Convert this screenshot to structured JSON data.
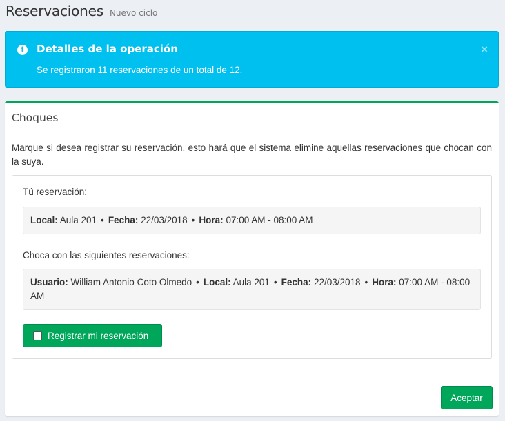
{
  "header": {
    "title": "Reservaciones",
    "subtitle": "Nuevo ciclo"
  },
  "alert": {
    "icon": "info-icon",
    "title": "Detalles de la operación",
    "message": "Se registraron 11 reservaciones de un total de 12.",
    "close_label": "×",
    "color": "#00c0ef"
  },
  "box": {
    "title": "Choques",
    "accent_color": "#00a65a",
    "description": "Marque si desea registrar su reservación, esto hará que el sistema elimine aquellas reservaciones que chocan con la suya.",
    "your_reservation_label": "Tú reservación:",
    "your_reservation": {
      "local_label": "Local:",
      "local": "Aula 201",
      "fecha_label": "Fecha:",
      "fecha": "22/03/2018",
      "hora_label": "Hora:",
      "hora": "07:00 AM - 08:00 AM"
    },
    "conflicts_label": "Choca con las siguientes reservaciones:",
    "conflicts": [
      {
        "usuario_label": "Usuario:",
        "usuario": "William Antonio Coto Olmedo",
        "local_label": "Local:",
        "local": "Aula 201",
        "fecha_label": "Fecha:",
        "fecha": "22/03/2018",
        "hora_label": "Hora:",
        "hora": "07:00 AM - 08:00 AM"
      }
    ],
    "separator": "•",
    "register_checkbox_label": "Registrar mi reservación",
    "register_checked": false,
    "accept_label": "Aceptar"
  }
}
